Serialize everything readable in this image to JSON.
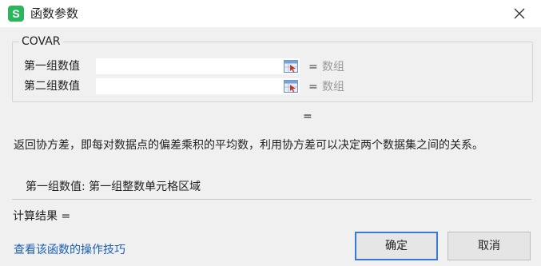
{
  "window": {
    "title": "函数参数",
    "app_icon_letter": "S"
  },
  "function": {
    "name": "COVAR",
    "args": [
      {
        "label": "第一组数值",
        "value": "",
        "eq": "=",
        "type": "数组"
      },
      {
        "label": "第二组数值",
        "value": "",
        "eq": "=",
        "type": "数组"
      }
    ],
    "result_eq": "=",
    "description": "返回协方差，即每对数据点的偏差乘积的平均数，利用协方差可以决定两个数据集之间的关系。",
    "param_description": "第一组数值:  第一组整数单元格区域"
  },
  "footer": {
    "calc_result": "计算结果 =",
    "help_link": "查看该函数的操作技巧",
    "ok_label": "确定",
    "cancel_label": "取消"
  },
  "colors": {
    "app_icon": "#2bb55c",
    "link": "#1a5fb4",
    "ok_border": "#3a78d6"
  },
  "icons": {
    "close": "close-icon",
    "ref_select": "cell-reference-icon"
  }
}
